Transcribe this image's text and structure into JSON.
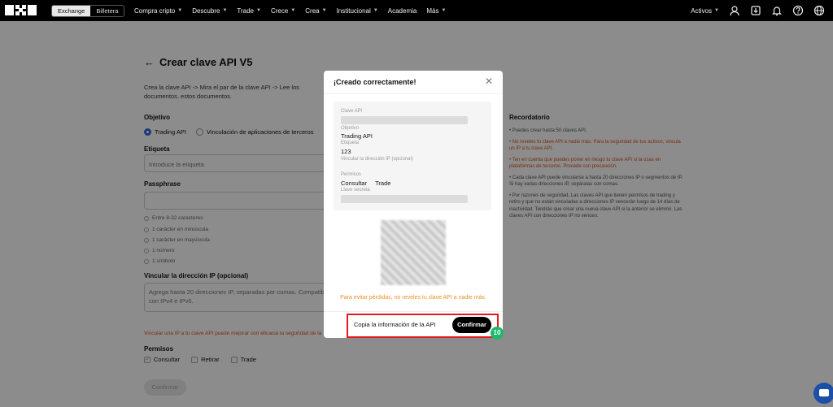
{
  "nav": {
    "tabs": [
      "Exchange",
      "Billetera"
    ],
    "items": [
      "Compra cripto",
      "Descubre",
      "Trade",
      "Crece",
      "Crea",
      "Institucional",
      "Academia",
      "Más"
    ],
    "activos": "Activos"
  },
  "page": {
    "title": "Crear clave API V5",
    "description": "Crea la clave API -> Mira el par de la clave API -> Lee los documentos. estos documentos.",
    "objetivo_label": "Objetivo",
    "objetivo_opt1": "Trading API",
    "objetivo_opt2": "Vinculación de aplicaciones de terceros",
    "etiqueta_label": "Etiqueta",
    "etiqueta_placeholder": "Introduce la etiqueta",
    "passphrase_label": "Passphrase",
    "rules": [
      "Entre 8-32 caracteres",
      "1 carácter en minúscula",
      "1 carácter en mayúscula",
      "1 número",
      "1 símbolo"
    ],
    "ip_label": "Vincular la dirección IP (opcional)",
    "ip_placeholder": "Agrega hasta 20 direcciones IP, separadas por comas. Compatible con IPv4 e IPv6.",
    "ip_warning": "Vincular una IP a tu clave API puede mejorar con eficacia la seguridad de la",
    "permisos_label": "Permisos",
    "permisos": [
      "Consultar",
      "Retirar",
      "Trade"
    ],
    "confirm_label": "Confirmar"
  },
  "reminder": {
    "title": "Recordatorio",
    "items": [
      {
        "text": "• Puedes crear hasta 50 claves API.",
        "warn": false
      },
      {
        "text": "• No reveles tu clave API a nadie más. Para la seguridad de tus activos, vincula un IP a tu clave API.",
        "warn": true
      },
      {
        "text": "• Ten en cuenta que puedes poner en riesgo tu clave API si la usas en plataformas de terceros. Procede con precaución.",
        "warn": true
      },
      {
        "text": "• Cada clave API puede vincularse a hasta 20 direcciones IP o segmentos de IP. Si hay varias direcciones IP, sepáralas con comas.",
        "warn": false
      },
      {
        "text": "• Por razones de seguridad, Las claves API que tienen permisos de trading y retiro y que no están vinculadas a direcciones IP vencerán luego de 14 días de inactividad. Tendrás que crear una nueva clave API si la anterior se eliminó. Las claves API con direcciones IP no vencen.",
        "warn": false
      }
    ]
  },
  "modal": {
    "title": "¡Creado correctamente!",
    "clave_label": "Clave API",
    "objetivo_label": "Objetivo",
    "objetivo_value": "Trading API",
    "etiqueta_label": "Etiqueta",
    "etiqueta_value": "123",
    "ip_label": "Vincular la dirección IP (opcional)",
    "permisos_label": "Permisos",
    "perm1": "Consultar",
    "perm2": "Trade",
    "secret_label": "Llave secreta",
    "warning": "Para evitar pérdidas, no reveles tu clave API a nadie más.",
    "copy_button": "Copia la información de la API",
    "confirm_button": "Confirmar",
    "step_number": "10"
  }
}
